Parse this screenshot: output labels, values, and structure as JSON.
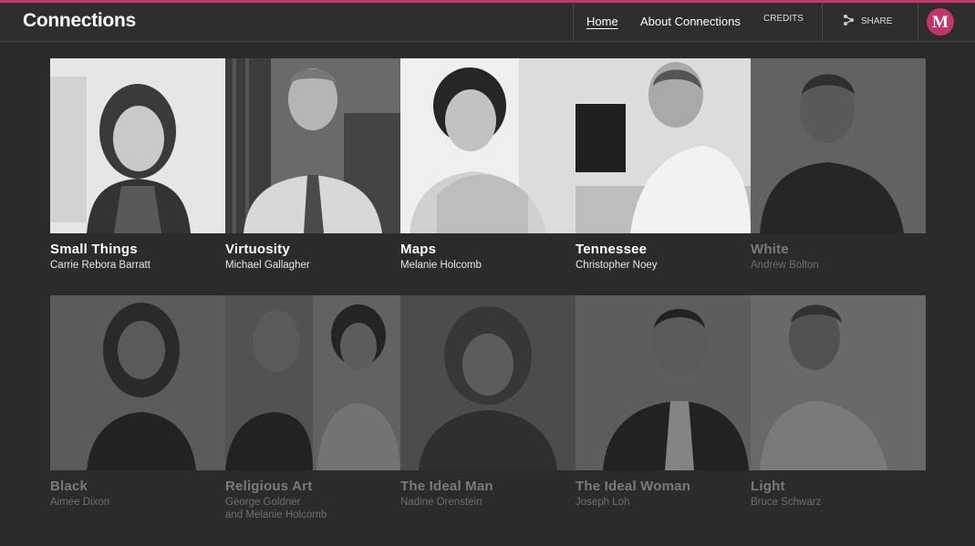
{
  "header": {
    "title": "Connections",
    "nav": {
      "home": "Home",
      "about": "About Connections",
      "credits": "CREDITS",
      "share": "SHARE"
    },
    "logo_letter": "M",
    "accent_color": "#c6336a"
  },
  "row1": [
    {
      "title": "Small Things",
      "author": "Carrie Rebora Barratt"
    },
    {
      "title": "Virtuosity",
      "author": "Michael Gallagher"
    },
    {
      "title": "Maps",
      "author": "Melanie Holcomb"
    },
    {
      "title": "Tennessee",
      "author": "Christopher Noey"
    },
    {
      "title": "White",
      "author": "Andrew Bolton"
    }
  ],
  "row2": [
    {
      "title": "Black",
      "author": "Aimee Dixon"
    },
    {
      "title": "Religious Art",
      "author": "George Goldner",
      "author2": "and Melanie Holcomb"
    },
    {
      "title": "The Ideal Man",
      "author": "Nadine Orenstein"
    },
    {
      "title": "The Ideal Woman",
      "author": "Joseph Loh"
    },
    {
      "title": "Light",
      "author": "Bruce Schwarz"
    }
  ]
}
